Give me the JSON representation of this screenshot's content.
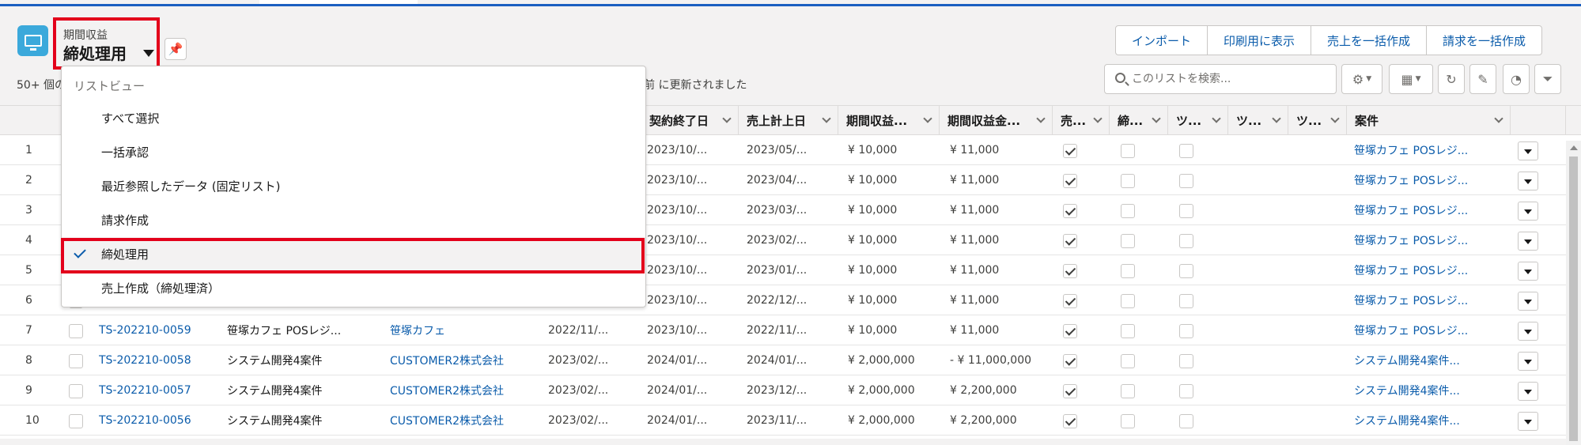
{
  "header": {
    "object_label": "期間収益",
    "list_view_name": "締処理用",
    "status_prefix": "50+ 個の",
    "status_suffix": "前 に更新されました",
    "actions": [
      "インポート",
      "印刷用に表示",
      "売上を一括作成",
      "請求を一括作成"
    ],
    "search_placeholder": "このリストを検索..."
  },
  "dropdown": {
    "header": "リストビュー",
    "items": [
      "すべて選択",
      "一括承認",
      "最近参照したデータ (固定リスト)",
      "請求作成",
      "締処理用",
      "売上作成（締処理済）"
    ],
    "selected": "締処理用"
  },
  "columns": [
    "契約終了日",
    "売上計上日",
    "期間収益...",
    "期間収益金...",
    "売...",
    "締...",
    "ツ...",
    "ツ...",
    "ツ...",
    "案件"
  ],
  "rows": [
    {
      "num": "1",
      "end": "2023/10/...",
      "sales": "2023/05/...",
      "rev": "¥ 10,000",
      "amt": "¥ 11,000",
      "c1": true,
      "c2": false,
      "c3": false,
      "project": "笹塚カフェ POSレジ..."
    },
    {
      "num": "2",
      "end": "2023/10/...",
      "sales": "2023/04/...",
      "rev": "¥ 10,000",
      "amt": "¥ 11,000",
      "c1": true,
      "c2": false,
      "c3": false,
      "project": "笹塚カフェ POSレジ..."
    },
    {
      "num": "3",
      "end": "2023/10/...",
      "sales": "2023/03/...",
      "rev": "¥ 10,000",
      "amt": "¥ 11,000",
      "c1": true,
      "c2": false,
      "c3": false,
      "project": "笹塚カフェ POSレジ..."
    },
    {
      "num": "4",
      "end": "2023/10/...",
      "sales": "2023/02/...",
      "rev": "¥ 10,000",
      "amt": "¥ 11,000",
      "c1": true,
      "c2": false,
      "c3": false,
      "project": "笹塚カフェ POSレジ..."
    },
    {
      "num": "5",
      "end": "2023/10/...",
      "sales": "2023/01/...",
      "rev": "¥ 10,000",
      "amt": "¥ 11,000",
      "c1": true,
      "c2": false,
      "c3": false,
      "project": "笹塚カフェ POSレジ..."
    },
    {
      "num": "6",
      "end": "2023/10/...",
      "sales": "2022/12/...",
      "rev": "¥ 10,000",
      "amt": "¥ 11,000",
      "c1": true,
      "c2": false,
      "c3": false,
      "project": "笹塚カフェ POSレジ..."
    },
    {
      "num": "7",
      "id": "TS-202210-0059",
      "name": "笹塚カフェ POSレジ...",
      "account": "笹塚カフェ",
      "start": "2022/11/...",
      "end": "2023/10/...",
      "sales": "2022/11/...",
      "rev": "¥ 10,000",
      "amt": "¥ 11,000",
      "c1": true,
      "c2": false,
      "c3": false,
      "project": "笹塚カフェ POSレジ..."
    },
    {
      "num": "8",
      "id": "TS-202210-0058",
      "name": "システム開発4案件",
      "account": "CUSTOMER2株式会社",
      "start": "2023/02/...",
      "end": "2024/01/...",
      "sales": "2024/01/...",
      "rev": "¥ 2,000,000",
      "amt": "- ¥ 11,000,000",
      "c1": true,
      "c2": false,
      "c3": false,
      "project": "システム開発4案件..."
    },
    {
      "num": "9",
      "id": "TS-202210-0057",
      "name": "システム開発4案件",
      "account": "CUSTOMER2株式会社",
      "start": "2023/02/...",
      "end": "2024/01/...",
      "sales": "2023/12/...",
      "rev": "¥ 2,000,000",
      "amt": "¥ 2,200,000",
      "c1": true,
      "c2": false,
      "c3": false,
      "project": "システム開発4案件..."
    },
    {
      "num": "10",
      "id": "TS-202210-0056",
      "name": "システム開発4案件",
      "account": "CUSTOMER2株式会社",
      "start": "2023/02/...",
      "end": "2024/01/...",
      "sales": "2023/11/...",
      "rev": "¥ 2,000,000",
      "amt": "¥ 2,200,000",
      "c1": true,
      "c2": false,
      "c3": false,
      "project": "システム開発4案件..."
    }
  ],
  "colors": {
    "link": "#0b5cab",
    "highlight": "#e3001b",
    "app_icon": "#3ba9db"
  }
}
